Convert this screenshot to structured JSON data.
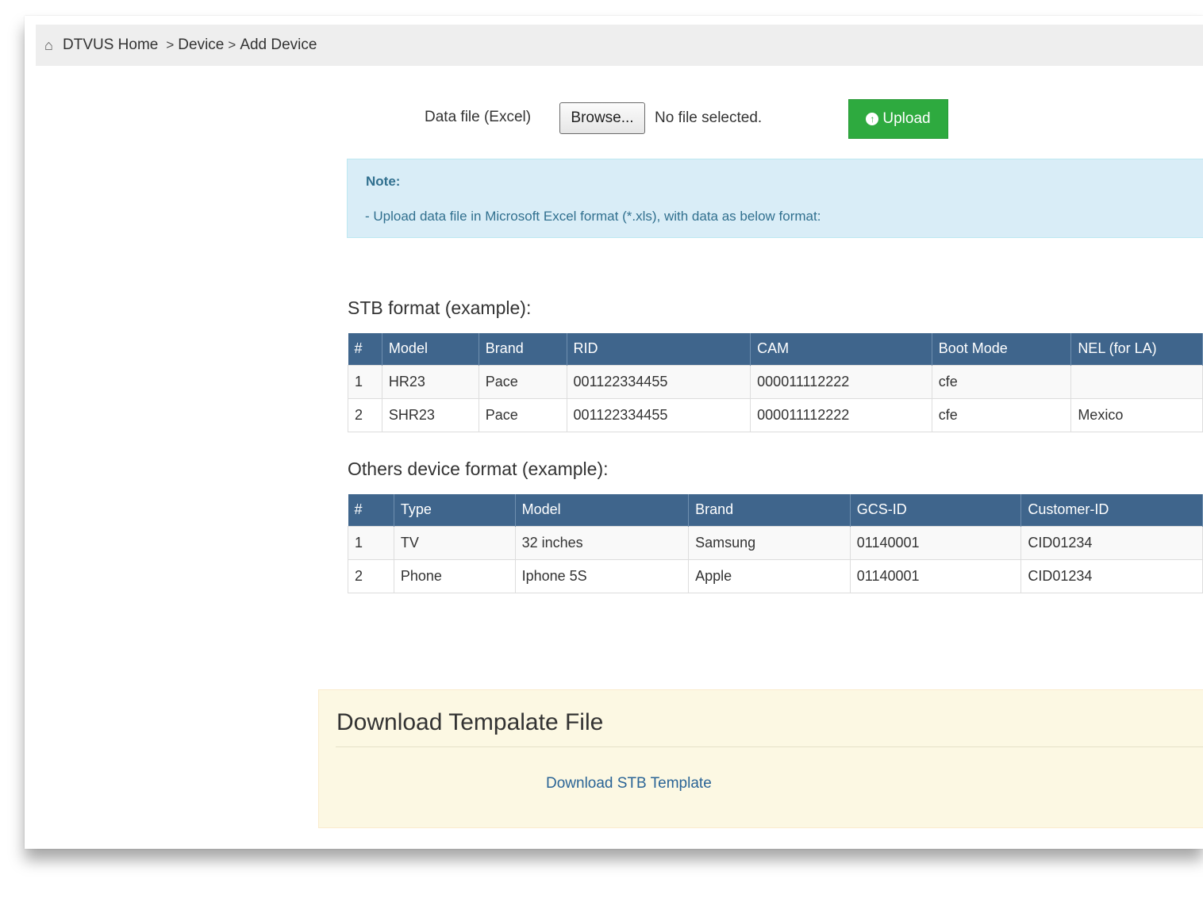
{
  "breadcrumb": {
    "home_icon": "home-icon",
    "items": [
      "DTVUS Home",
      "Device",
      "Add Device"
    ],
    "separator": ">"
  },
  "upload": {
    "label": "Data file (Excel)",
    "browse_label": "Browse...",
    "file_status": "No file selected.",
    "upload_icon": "circle-arrow-up-icon",
    "upload_label": "Upload",
    "upload_color": "#2eaa3f"
  },
  "note": {
    "title": "Note:",
    "text": "- Upload data file in Microsoft Excel format (*.xls), with data as below format:"
  },
  "stb": {
    "title": "STB format (example):",
    "headers": [
      "#",
      "Model",
      "Brand",
      "RID",
      "CAM",
      "Boot Mode",
      "NEL (for LA)"
    ],
    "rows": [
      [
        "1",
        "HR23",
        "Pace",
        "001122334455",
        "000011112222",
        "cfe",
        ""
      ],
      [
        "2",
        "SHR23",
        "Pace",
        "001122334455",
        "000011112222",
        "cfe",
        "Mexico"
      ]
    ]
  },
  "others": {
    "title": "Others device format (example):",
    "headers": [
      "#",
      "Type",
      "Model",
      "Brand",
      "GCS-ID",
      "Customer-ID"
    ],
    "rows": [
      [
        "1",
        "TV",
        "32 inches",
        "Samsung",
        "01140001",
        "CID01234"
      ],
      [
        "2",
        "Phone",
        "Iphone 5S",
        "Apple",
        "01140001",
        "CID01234"
      ]
    ]
  },
  "download": {
    "title": "Download Tempalate File",
    "link": "Download STB Template"
  },
  "colors": {
    "table_header": "#3f658c",
    "note_bg": "#d9edf7",
    "note_text": "#31708f",
    "panel_bg": "#fcf8e3",
    "link": "#2a6496"
  }
}
